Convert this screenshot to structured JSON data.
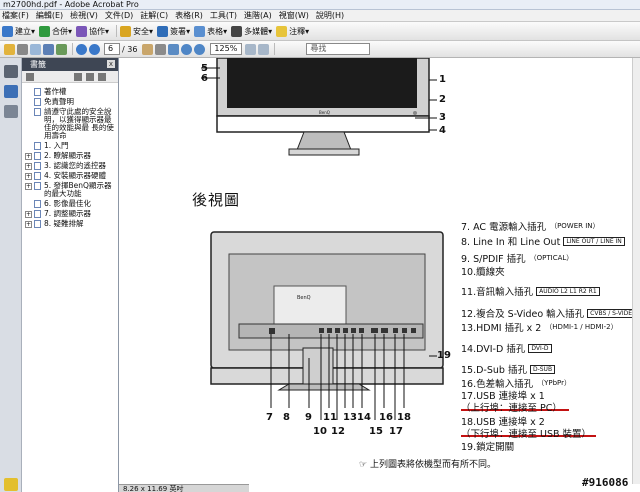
{
  "window": {
    "title": "m2700hd.pdf - Adobe Acrobat Pro"
  },
  "menu": [
    "檔案(F)",
    "編輯(E)",
    "檢視(V)",
    "文件(D)",
    "註解(C)",
    "表格(R)",
    "工具(T)",
    "進階(A)",
    "視窗(W)",
    "說明(H)"
  ],
  "toolbar": {
    "create": "建立",
    "combine": "合併",
    "collaborate": "協作",
    "secure": "安全",
    "sign": "簽署",
    "forms": "表格",
    "multimedia": "多媒體",
    "comment": "注釋"
  },
  "nav": {
    "page": "6",
    "total": "/ 36",
    "zoom": "125%",
    "find_placeholder": "尋找"
  },
  "panel": {
    "title": "書籤",
    "close": "x",
    "bookmarks": [
      {
        "label": "著作權",
        "exp": false
      },
      {
        "label": "免責聲明",
        "exp": false
      },
      {
        "label": "請遵守此處的安全說明，以獲得顯示器最佳的效能與最 長的使用壽命",
        "exp": false
      },
      {
        "label": "1. 入門",
        "exp": false
      },
      {
        "label": "2. 瞭解顯示器",
        "exp": true
      },
      {
        "label": "3. 認識您的遙控器",
        "exp": true
      },
      {
        "label": "4. 安裝顯示器硬體",
        "exp": true
      },
      {
        "label": "5. 發揮BenQ顯示器的最大功能",
        "exp": true
      },
      {
        "label": "6. 影像最佳化",
        "exp": false
      },
      {
        "label": "7. 調整顯示器",
        "exp": true
      },
      {
        "label": "8. 疑難排解",
        "exp": true
      }
    ]
  },
  "status": {
    "pagesize": "8.26 x 11.69 英吋"
  },
  "doc": {
    "heading": "後視圖",
    "front_callouts": [
      "5",
      "6",
      "1",
      "2",
      "3",
      "4"
    ],
    "rear_callouts": [
      "7",
      "8",
      "9",
      "10",
      "11",
      "12",
      "13",
      "14",
      "15",
      "16",
      "17",
      "18",
      "19"
    ],
    "specs": [
      {
        "text": "7.  AC 電源輸入插孔",
        "tag": "（POWER IN）"
      },
      {
        "text": "8.  Line In 和 Line Out",
        "tag": "LINE OUT / LINE IN"
      },
      {
        "text": "9.  S/PDIF 插孔",
        "tag": "（OPTICAL）"
      },
      {
        "text": "10.纜線夾",
        "tag": ""
      },
      {
        "text": "11.音訊輸入插孔",
        "tag": "AUDIO L2 L1 R2 R1"
      },
      {
        "text": "12.複合及 S-Video 輸入插孔",
        "tag": "CVBS / S-VIDEO"
      },
      {
        "text": "13.HDMI 插孔 x 2",
        "tag": "（HDMI-1 / HDMI-2）"
      },
      {
        "text": "14.DVI-D 插孔",
        "tag": "DVI-D"
      },
      {
        "text": "15.D-Sub 插孔",
        "tag": "D-SUB"
      },
      {
        "text": "16.色差輸入插孔",
        "tag": "（YPbPr）"
      },
      {
        "text": "17.USB 連接埠 x 1",
        "tag": ""
      },
      {
        "text": "（上行埠：連接至 PC）",
        "tag": ""
      },
      {
        "text": "18.USB 連接埠 x 2",
        "tag": ""
      },
      {
        "text": "（下行埠：連接至 USB 裝置）",
        "tag": ""
      },
      {
        "text": "19.鎖定開關",
        "tag": ""
      }
    ],
    "note": "上列圖表將依機型而有所不同。",
    "brand": "BenQ"
  },
  "watermark": "#916086"
}
